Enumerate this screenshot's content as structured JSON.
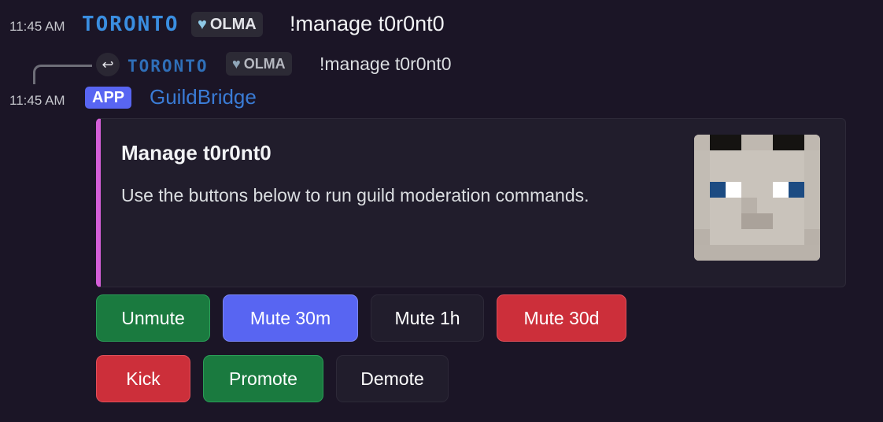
{
  "messages": [
    {
      "time": "11:45 AM",
      "author": "TORONTO",
      "guild_tag": "OLMA",
      "content": "!manage t0r0nt0"
    }
  ],
  "reply": {
    "author": "TORONTO",
    "guild_tag": "OLMA",
    "content": "!manage t0r0nt0",
    "icon": "reply-arrow-icon"
  },
  "bot_message": {
    "time": "11:45 AM",
    "app_badge": "APP",
    "author": "GuildBridge",
    "embed": {
      "accent_color": "#d45fd8",
      "title": "Manage t0r0nt0",
      "description": "Use the buttons below to run guild moderation commands.",
      "thumbnail": "minecraft-skin-head-avatar"
    },
    "buttons_row1": [
      {
        "label": "Unmute",
        "style": "green"
      },
      {
        "label": "Mute 30m",
        "style": "blue"
      },
      {
        "label": "Mute 1h",
        "style": "dark"
      },
      {
        "label": "Mute 30d",
        "style": "red"
      }
    ],
    "buttons_row2": [
      {
        "label": "Kick",
        "style": "red"
      },
      {
        "label": "Promote",
        "style": "green"
      },
      {
        "label": "Demote",
        "style": "dark"
      }
    ]
  },
  "colors": {
    "background": "#1b1526",
    "username": "#3a8ee0",
    "bot_name": "#3a7bd5",
    "app_badge": "#5865f2"
  }
}
